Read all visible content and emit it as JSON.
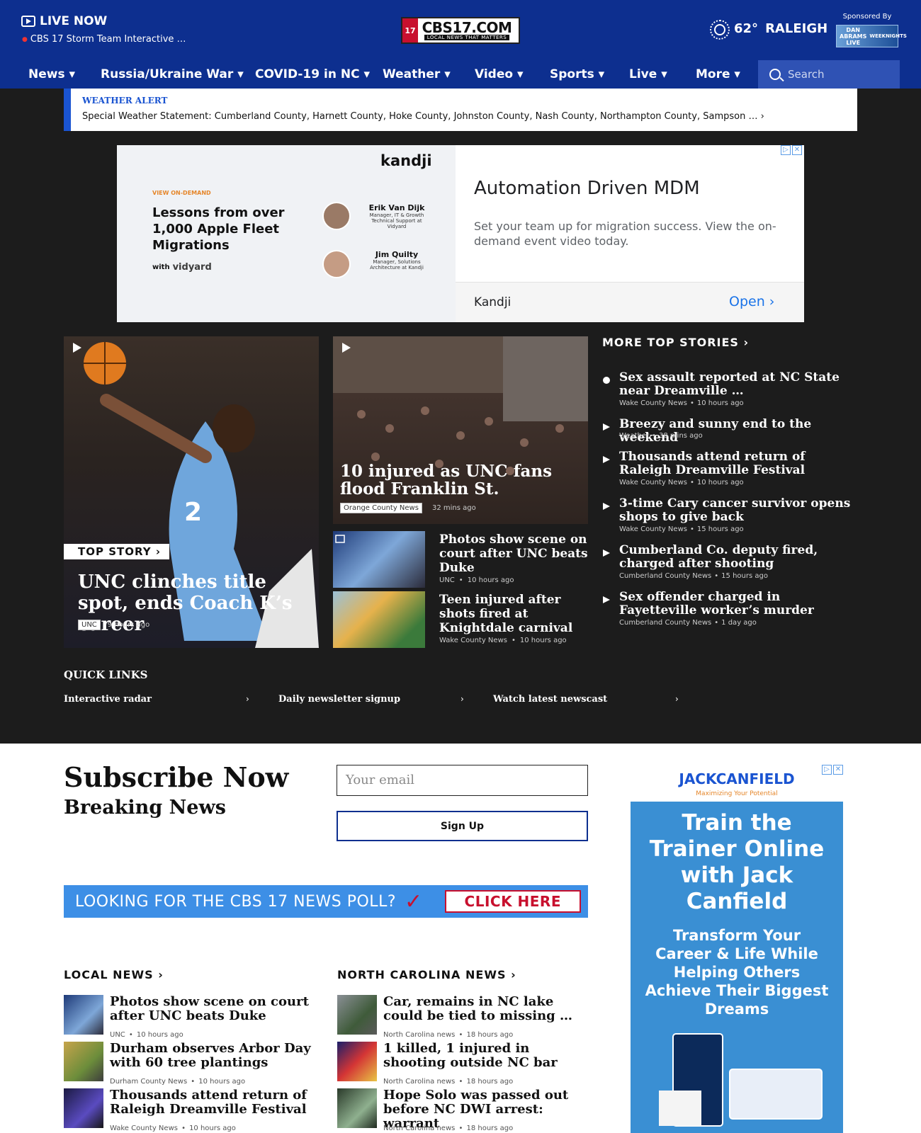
{
  "header": {
    "live_now": "LIVE NOW",
    "live_sub": "CBS 17 Storm Team Interactive …",
    "logo_text": "CBS17.COM",
    "logo_tagline": "LOCAL NEWS THAT MATTERS",
    "logo_badge": "17",
    "temperature": "62°",
    "city": "RALEIGH",
    "sponsored_by": "Sponsored By",
    "sponsor_name": "DAN ABRAMS LIVE",
    "sponsor_sub": "WEEKNIGHTS"
  },
  "nav": {
    "items": [
      "News ▾",
      "Russia/Ukraine War ▾",
      "COVID-19 in NC ▾",
      "Weather ▾",
      "Video ▾",
      "Sports ▾",
      "Live ▾",
      "More ▾"
    ],
    "search_placeholder": "Search"
  },
  "alert": {
    "title": "WEATHER ALERT",
    "message": "Special Weather Statement: Cumberland County, Harnett County, Hoke County, Johnston County, Nash County, Northampton County, Sampson … ›"
  },
  "ad1": {
    "brand": "kandji",
    "eyebrow": "VIEW ON-DEMAND",
    "headline": "Lessons from over 1,000 Apple Fleet Migrations",
    "with": "with",
    "partner": "vidyard",
    "speaker1_name": "Erik Van Dijk",
    "speaker1_role": "Manager, IT & Growth Technical Support at Vidyard",
    "speaker2_name": "Jim Quilty",
    "speaker2_role": "Manager, Solutions Architecture at Kandji",
    "title": "Automation Driven MDM",
    "body": "Set your team up for migration success. View the on-demand event video today.",
    "advertiser": "Kandji",
    "cta": "Open"
  },
  "top_story": {
    "label": "TOP STORY",
    "title": "UNC clinches title spot, ends Coach K’s career",
    "tag": "UNC",
    "time": "9 hours ago"
  },
  "second_story": {
    "title": "10 injured as UNC fans flood Franklin St.",
    "tag": "Orange County News",
    "time": "32 mins ago"
  },
  "small_stories": [
    {
      "title": "Photos show scene on court after UNC beats Duke",
      "tag": "UNC",
      "time": "10 hours ago"
    },
    {
      "title": "Teen injured after shots fired at Knightdale carnival",
      "tag": "Wake County News",
      "time": "10 hours ago"
    }
  ],
  "more_top": {
    "heading": "MORE TOP STORIES",
    "items": [
      {
        "title": "Sex assault reported at NC State near Dreamville …",
        "tag": "Wake County News",
        "time": "10 hours ago"
      },
      {
        "title": "Breezy and sunny end to the weekend",
        "tag": "Weather",
        "time": "38 mins ago"
      },
      {
        "title": "Thousands attend return of Raleigh Dreamville Festival",
        "tag": "Wake County News",
        "time": "10 hours ago"
      },
      {
        "title": "3-time Cary cancer survivor opens shops to give back",
        "tag": "Wake County News",
        "time": "15 hours ago"
      },
      {
        "title": "Cumberland Co. deputy fired, charged after shooting",
        "tag": "Cumberland County News",
        "time": "15 hours ago"
      },
      {
        "title": "Sex offender charged in Fayetteville worker’s murder",
        "tag": "Cumberland County News",
        "time": "1 day ago"
      }
    ]
  },
  "quick_links": {
    "heading": "QUICK LINKS",
    "items": [
      "Interactive radar",
      "Daily newsletter signup",
      "Watch latest newscast"
    ]
  },
  "subscribe": {
    "title": "Subscribe Now",
    "subtitle": "Breaking News",
    "email_placeholder": "Your email",
    "button": "Sign Up"
  },
  "poll": {
    "text": "LOOKING FOR THE CBS 17 NEWS POLL?",
    "cta": "CLICK HERE"
  },
  "ad2": {
    "brand": "JACKCANFIELD",
    "brand_sub": "Maximizing Your Potential",
    "headline": "Train the Trainer Online with Jack Canfield",
    "body": "Transform Your Career & Life While Helping Others Achieve Their Biggest Dreams"
  },
  "local_news": {
    "heading": "LOCAL NEWS",
    "items": [
      {
        "title": "Photos show scene on court after UNC beats Duke",
        "tag": "UNC",
        "time": "10 hours ago"
      },
      {
        "title": "Durham observes Arbor Day with 60 tree plantings",
        "tag": "Durham County News",
        "time": "10 hours ago"
      },
      {
        "title": "Thousands attend return of Raleigh Dreamville Festival",
        "tag": "Wake County News",
        "time": "10 hours ago"
      }
    ]
  },
  "nc_news": {
    "heading": "NORTH CAROLINA NEWS",
    "items": [
      {
        "title": "Car, remains in NC lake could be tied to missing …",
        "tag": "North Carolina news",
        "time": "18 hours ago"
      },
      {
        "title": "1 killed, 1 injured in shooting outside NC bar",
        "tag": "North Carolina news",
        "time": "18 hours ago"
      },
      {
        "title": "Hope Solo was passed out before NC DWI arrest: warrant",
        "tag": "North Carolina news",
        "time": "18 hours ago"
      }
    ]
  },
  "colors": {
    "brand": "#0d2f8f",
    "dark": "#1c1c1c",
    "alert_accent": "#1a54d1"
  }
}
